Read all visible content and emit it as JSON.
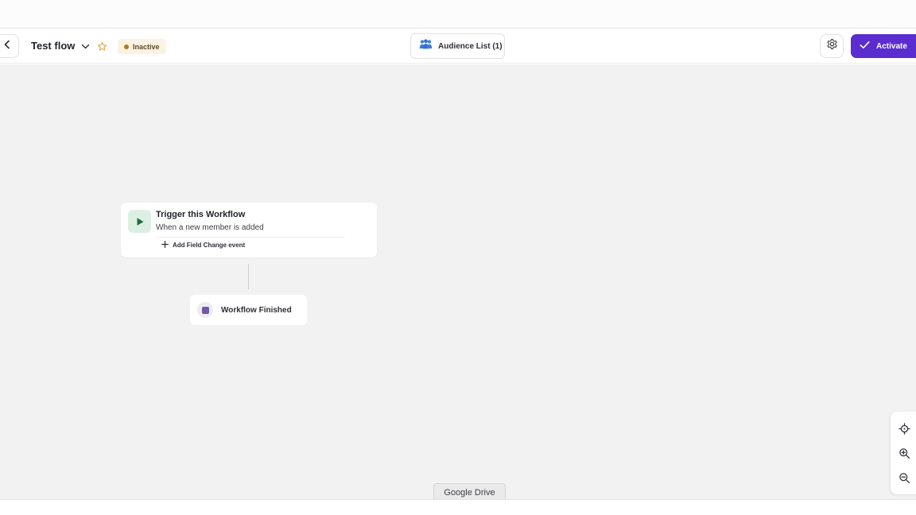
{
  "header": {
    "flow_title": "Test flow",
    "status": "Inactive",
    "audience_label": "Audience List (1)",
    "activate_label": "Activate"
  },
  "trigger": {
    "title": "Trigger this Workflow",
    "subtitle": "When a new member is added",
    "add_field_label": "Add Field Change event"
  },
  "finished": {
    "label": "Workflow Finished"
  },
  "taskbar": {
    "tab_label": "Google Drive"
  },
  "icons": {
    "back": "chevron-left-icon",
    "dropdown": "chevron-down-icon",
    "star": "star-icon",
    "audience": "people-group-icon",
    "settings": "gear-icon",
    "activate": "check-icon",
    "trigger": "play-icon",
    "add": "plus-icon",
    "finished": "stop-square-icon",
    "recenter": "crosshair-icon",
    "zoom_in": "zoom-in-icon",
    "zoom_out": "zoom-out-icon"
  },
  "colors": {
    "accent": "#5b2ccf",
    "status_badge_bg": "#fbf2e2",
    "status_dot": "#b07a1b",
    "trigger_icon_bg": "#dcefe3",
    "trigger_icon": "#1f6b3f",
    "finished_square": "#6e5aa8",
    "canvas_bg": "#f2f2f2"
  }
}
